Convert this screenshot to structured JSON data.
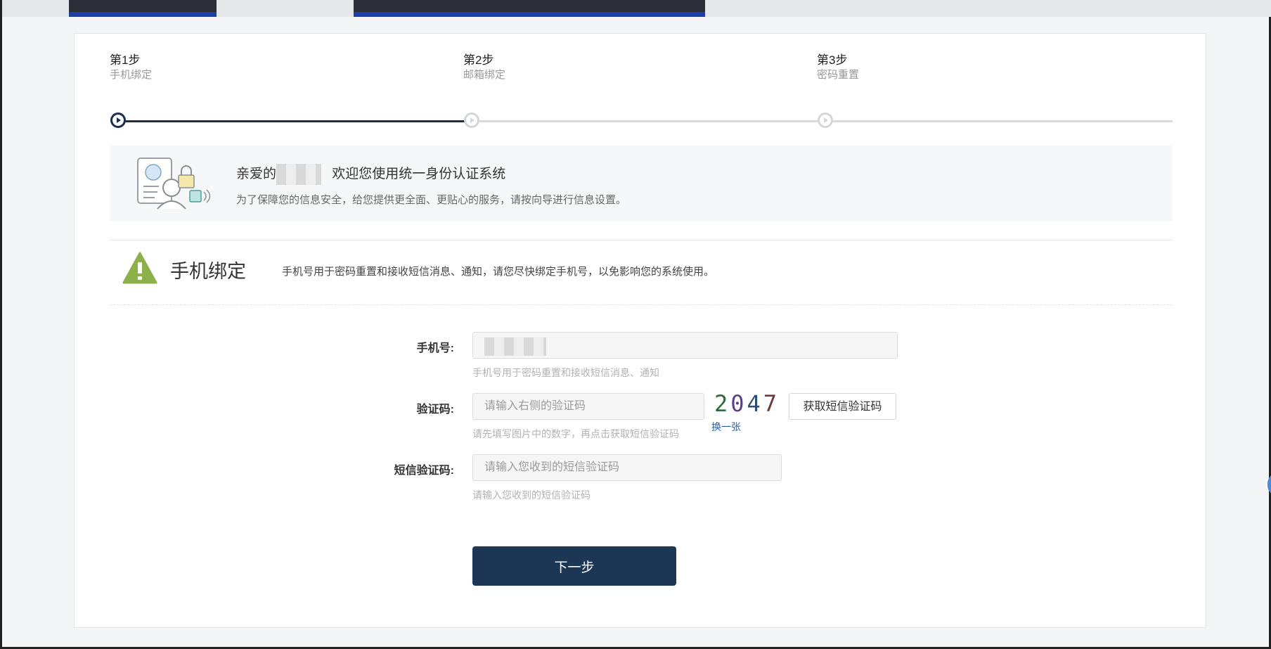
{
  "steps": [
    {
      "title": "第1步",
      "subtitle": "手机绑定"
    },
    {
      "title": "第2步",
      "subtitle": "邮箱绑定"
    },
    {
      "title": "第3步",
      "subtitle": "密码重置"
    }
  ],
  "welcome": {
    "greeting_prefix": "亲爱的",
    "greeting_suffix": "欢迎您使用统一身份认证系统",
    "subtitle": "为了保障您的信息安全，给您提供更全面、更贴心的服务，请按向导进行信息设置。"
  },
  "section": {
    "title": "手机绑定",
    "description": "手机号用于密码重置和接收短信消息、通知，请您尽快绑定手机号，以免影响您的系统使用。"
  },
  "form": {
    "phone": {
      "label": "手机号:",
      "hint": "手机号用于密码重置和接收短信消息、通知"
    },
    "captcha": {
      "label": "验证码:",
      "placeholder": "请输入右侧的验证码",
      "hint": "请先填写图片中的数字，再点击获取短信验证码",
      "image_text": [
        "2",
        "0",
        "4",
        "7"
      ],
      "refresh_label": "换一张",
      "sms_button_label": "获取短信验证码"
    },
    "sms_code": {
      "label": "短信验证码:",
      "placeholder": "请输入您收到的短信验证码",
      "hint": "请输入您收到的短信验证码"
    },
    "next_button_label": "下一步"
  },
  "colors": {
    "primary": "#1e3656",
    "warning_icon": "#8cb04a",
    "link": "#2a5fa8"
  }
}
